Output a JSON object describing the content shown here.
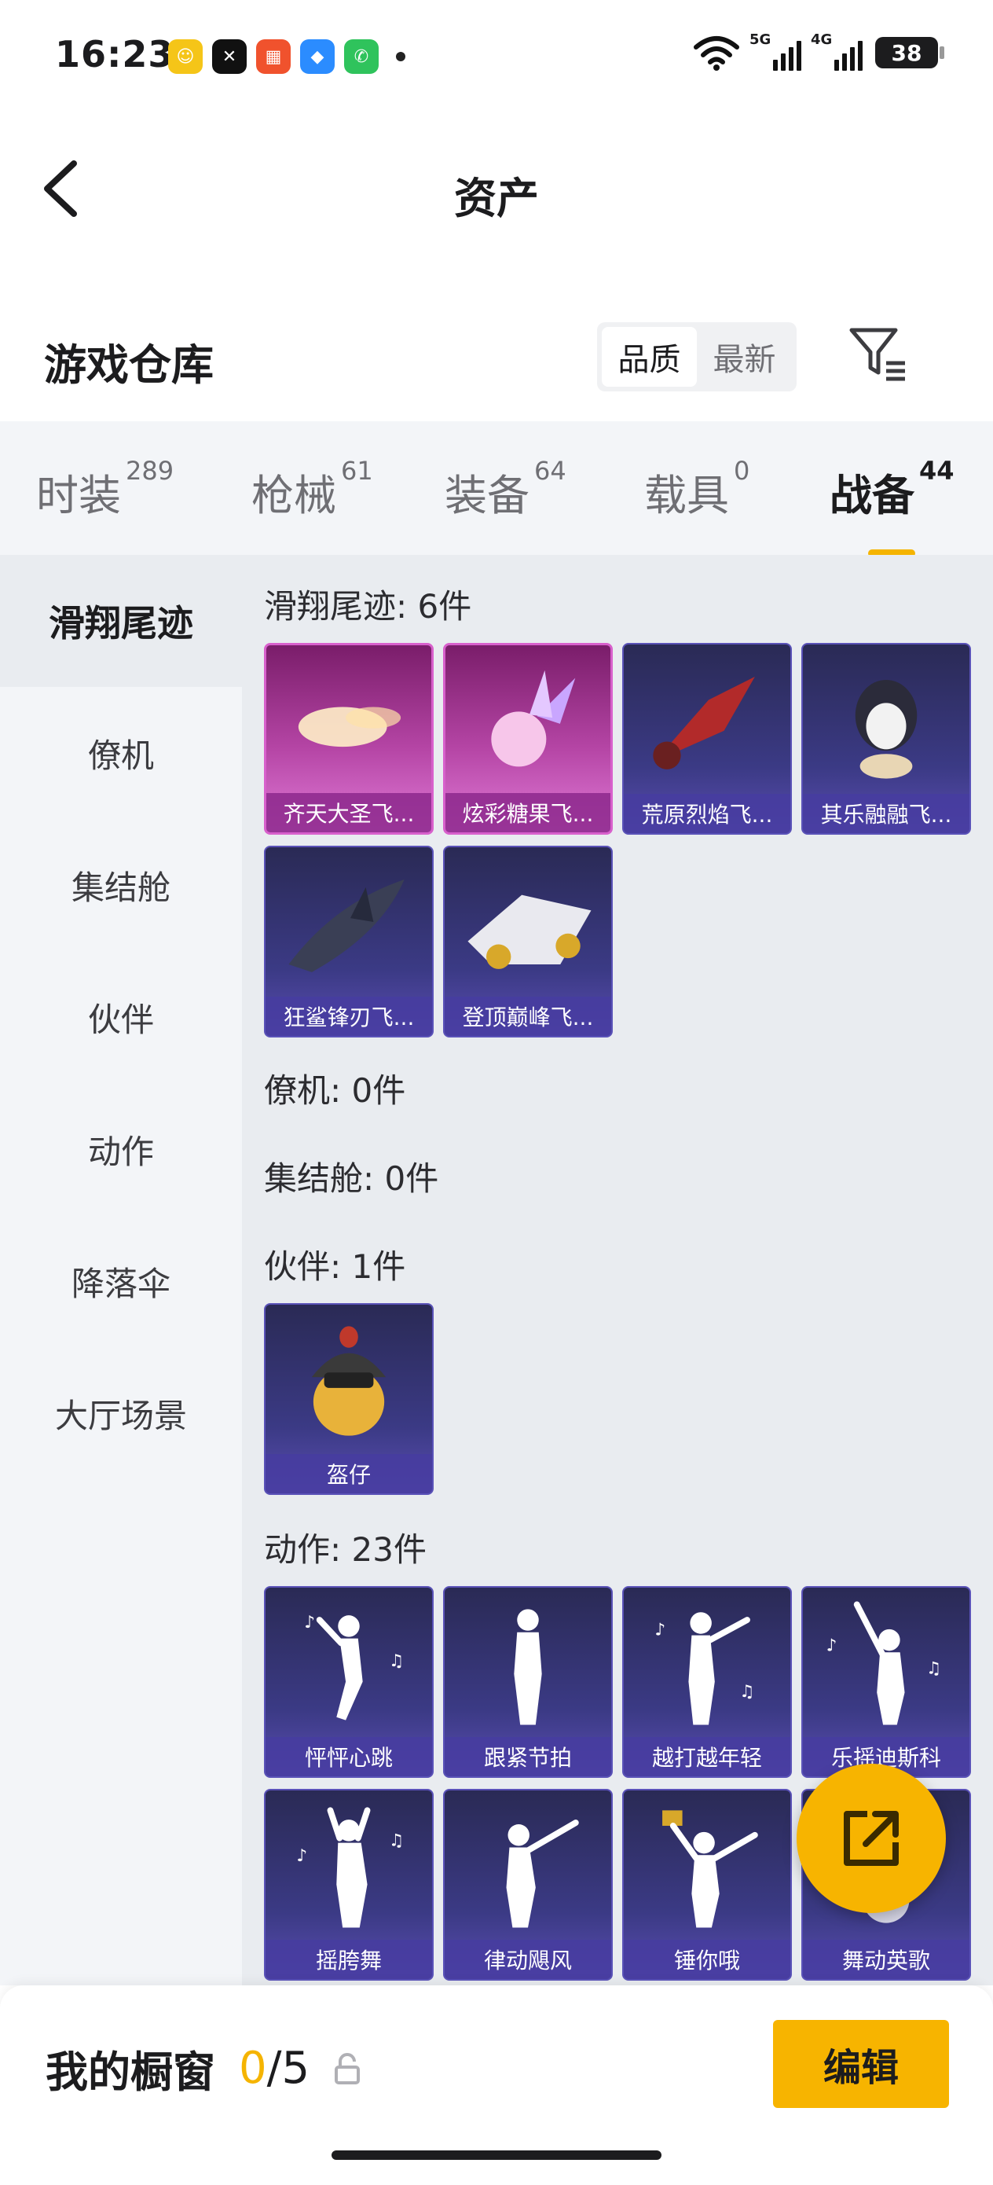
{
  "status_bar": {
    "time": "16:23",
    "signal_1": "5G",
    "signal_2": "4G",
    "battery": "38"
  },
  "header": {
    "title": "资产",
    "back_icon": "chevron-left-icon"
  },
  "warehouse": {
    "title": "游戏仓库",
    "sort_options": [
      "品质",
      "最新"
    ],
    "sort_selected": "品质",
    "filter_icon": "filter-icon"
  },
  "category_tabs": [
    {
      "label": "时装",
      "count": "289"
    },
    {
      "label": "枪械",
      "count": "61"
    },
    {
      "label": "装备",
      "count": "64"
    },
    {
      "label": "载具",
      "count": "0"
    },
    {
      "label": "战备",
      "count": "44",
      "active": true
    }
  ],
  "side_nav": [
    "滑翔尾迹",
    "僚机",
    "集结舱",
    "伙伴",
    "动作",
    "降落伞",
    "大厅场景"
  ],
  "sections": {
    "glide": {
      "heading": "滑翔尾迹: 6件",
      "items": [
        "齐天大圣飞...",
        "炫彩糖果飞...",
        "荒原烈焰飞...",
        "其乐融融飞...",
        "狂鲨锋刃飞...",
        "登顶巅峰飞..."
      ]
    },
    "wingman": {
      "heading": "僚机: 0件"
    },
    "capsule": {
      "heading": "集结舱: 0件"
    },
    "partner": {
      "heading": "伙伴: 1件",
      "items": [
        "盔仔"
      ]
    },
    "emote": {
      "heading": "动作: 23件",
      "items": [
        "怦怦心跳",
        "跟紧节拍",
        "越打越年轻",
        "乐摇迪斯科",
        "摇胯舞",
        "律动飓风",
        "锤你哦",
        "舞动英歌"
      ]
    }
  },
  "bottom_bar": {
    "title": "我的橱窗",
    "count_current": "0",
    "count_total": "/5",
    "edit_label": "编辑"
  },
  "colors": {
    "accent": "#F7B400",
    "card_purple": "#3B3A85",
    "card_pink": "#B545A5"
  }
}
